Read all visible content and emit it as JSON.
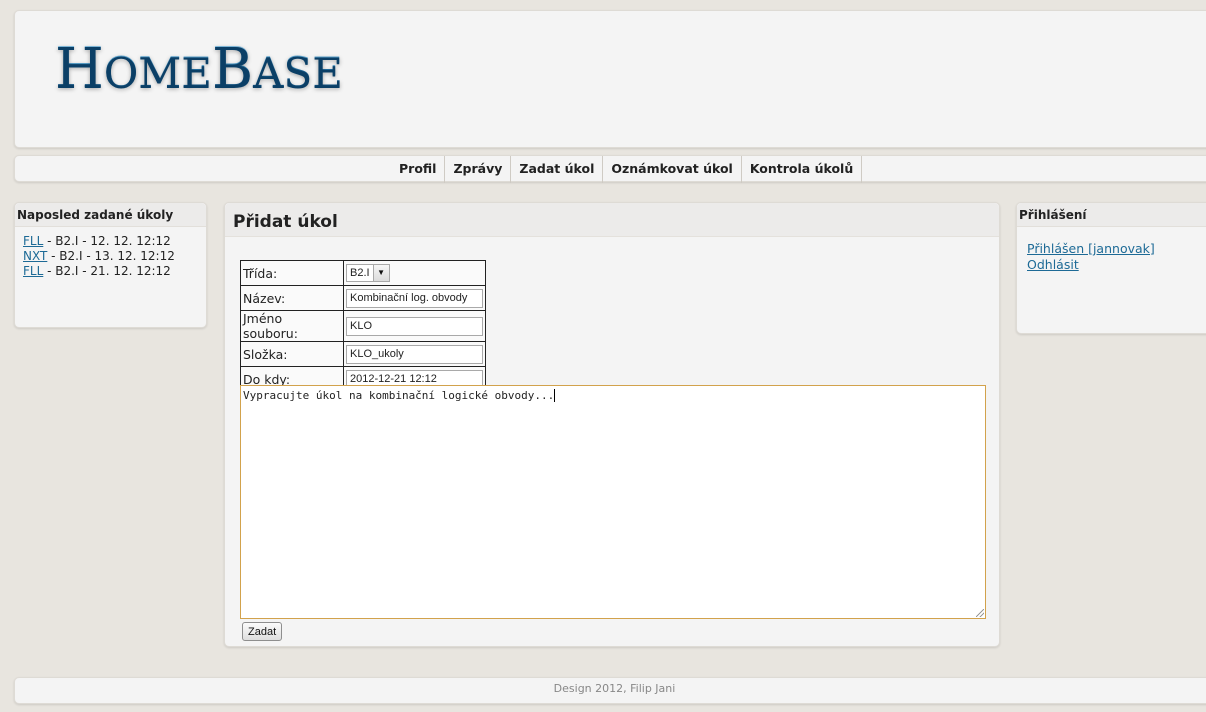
{
  "logo": {
    "text": "HomeBase"
  },
  "nav": {
    "items": [
      {
        "label": "Profil"
      },
      {
        "label": "Zprávy"
      },
      {
        "label": "Zadat úkol"
      },
      {
        "label": "Oznámkovat úkol"
      },
      {
        "label": "Kontrola úkolů"
      }
    ]
  },
  "left": {
    "title": "Naposled zadané úkoly",
    "items": [
      {
        "link": "FLL",
        "text": " - B2.I - 12. 12. 12:12"
      },
      {
        "link": "NXT",
        "text": " - B2.I - 13. 12. 12:12"
      },
      {
        "link": "FLL",
        "text": " - B2.I - 21. 12. 12:12"
      }
    ]
  },
  "main": {
    "title": "Přidat úkol",
    "form": {
      "class_label": "Třída:",
      "class_value": "B2.I",
      "name_label": "Název:",
      "name_value": "Kombinační log. obvody",
      "filename_label": "Jméno souboru:",
      "filename_value": "KLO",
      "folder_label": "Složka:",
      "folder_value": "KLO_ukoly",
      "due_label": "Do kdy:",
      "due_value": "2012-12-21 12:12",
      "description": "Vypracujte úkol na kombinační logické obvody...",
      "submit_label": "Zadat"
    }
  },
  "right": {
    "title": "Přihlášení",
    "logged_in": "Přihlášen [jannovak]",
    "logout": "Odhlásit"
  },
  "footer": {
    "text": "Design 2012, Filip Jani"
  },
  "colors": {
    "link": "#1d6a96",
    "logo": "#1f6fa4",
    "textarea_border": "#d2a24c",
    "background": "#e8e5df"
  }
}
